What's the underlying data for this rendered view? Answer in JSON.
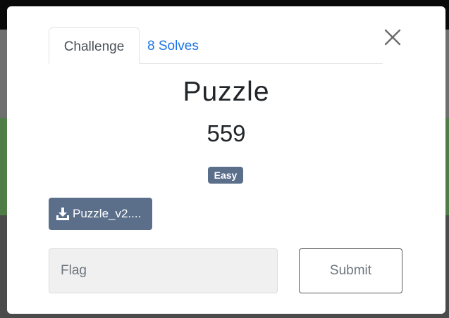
{
  "tabs": {
    "challenge_label": "Challenge",
    "solves_label": "8 Solves"
  },
  "challenge": {
    "name": "Puzzle",
    "value": "559",
    "difficulty": "Easy",
    "file_label": "Puzzle_v2...."
  },
  "form": {
    "flag_placeholder": "Flag",
    "flag_value": "",
    "submit_label": "Submit"
  },
  "icons": {
    "close": "close-icon",
    "download": "download-icon"
  },
  "colors": {
    "accent_link": "#1a73e8",
    "badge_bg": "#5b6f8b",
    "file_button_bg": "#5b6f8b"
  }
}
